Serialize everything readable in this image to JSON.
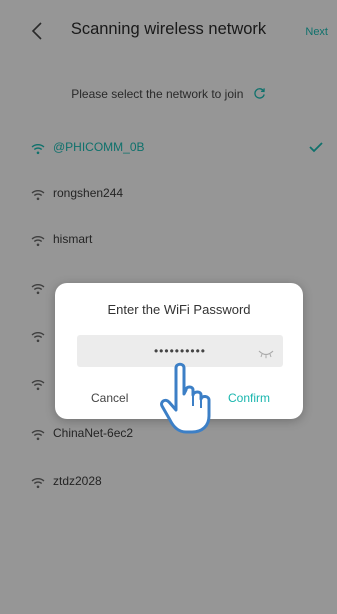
{
  "header": {
    "back_icon": "chevron-left-icon",
    "title": "Scanning wireless network",
    "next_label": "Next"
  },
  "subtitle": {
    "text": "Please select the network to join",
    "refresh_icon": "refresh-icon"
  },
  "networks": [
    {
      "name": "@PHICOMM_0B",
      "selected": true
    },
    {
      "name": "rongshen244",
      "selected": false
    },
    {
      "name": "hismart",
      "selected": false
    },
    {
      "name": "",
      "selected": false
    },
    {
      "name": "",
      "selected": false
    },
    {
      "name": "",
      "selected": false
    },
    {
      "name": "ChinaNet-6ec2",
      "selected": false
    },
    {
      "name": "ztdz2028",
      "selected": false
    }
  ],
  "dialog": {
    "title": "Enter the WiFi Password",
    "password_value": "••••••••••",
    "eye_icon": "eye-closed-icon",
    "cancel_label": "Cancel",
    "confirm_label": "Confirm"
  },
  "colors": {
    "accent": "#19b6ae",
    "background": "#f2f2f2"
  }
}
